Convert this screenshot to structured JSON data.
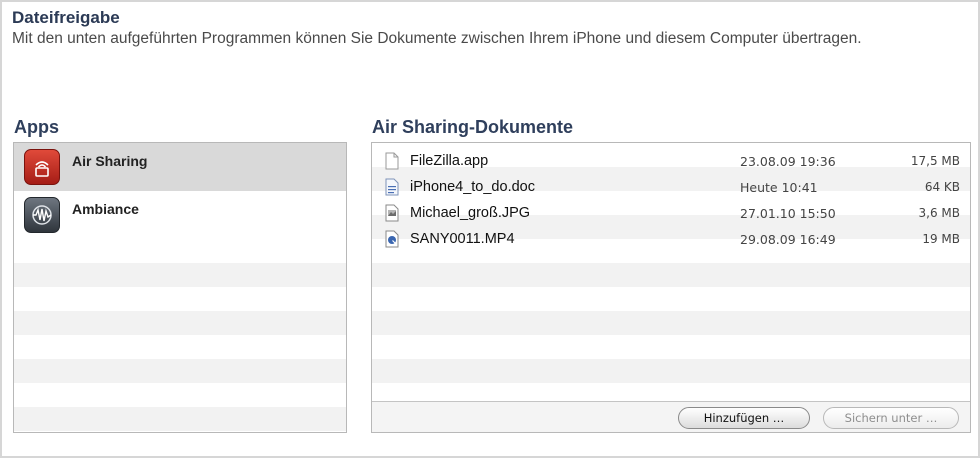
{
  "section": {
    "title": "Dateifreigabe",
    "description": "Mit den unten aufgeführten Programmen können Sie Dokumente zwischen Ihrem iPhone und diesem Computer übertragen."
  },
  "apps": {
    "title": "Apps",
    "items": [
      {
        "label": "Air Sharing",
        "icon": "air-sharing-icon",
        "selected": true
      },
      {
        "label": "Ambiance",
        "icon": "ambiance-icon",
        "selected": false
      }
    ]
  },
  "documents": {
    "title": "Air Sharing-Dokumente",
    "files": [
      {
        "name": "FileZilla.app",
        "date": "23.08.09 19:36",
        "size": "17,5 MB",
        "icon": "app-file-icon"
      },
      {
        "name": "iPhone4_to_do.doc",
        "date": "Heute 10:41",
        "size": "64 KB",
        "icon": "doc-file-icon"
      },
      {
        "name": "Michael_groß.JPG",
        "date": "27.01.10 15:50",
        "size": "3,6 MB",
        "icon": "jpg-file-icon"
      },
      {
        "name": "SANY0011.MP4",
        "date": "29.08.09 16:49",
        "size": "19 MB",
        "icon": "video-file-icon"
      }
    ],
    "add_button": "Hinzufügen …",
    "save_button": "Sichern unter …"
  },
  "colors": {
    "title": "#2b3a55",
    "selected_row": "#d9d9d9",
    "stripe": "#f2f2f2"
  }
}
